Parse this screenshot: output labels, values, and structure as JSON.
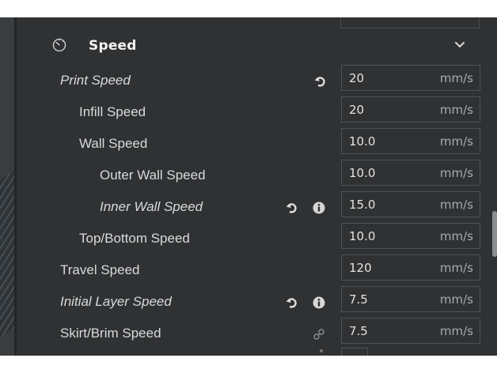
{
  "section": {
    "title": "Speed",
    "icon": "speedometer-icon",
    "chevron": "chevron-down-icon"
  },
  "rows": [
    {
      "label": "Print Speed",
      "italic": true,
      "indent": 0,
      "value": "20",
      "unit": "mm/s",
      "icons": [
        "reset-icon"
      ]
    },
    {
      "label": "Infill Speed",
      "italic": false,
      "indent": 1,
      "value": "20",
      "unit": "mm/s",
      "icons": []
    },
    {
      "label": "Wall Speed",
      "italic": false,
      "indent": 1,
      "value": "10.0",
      "unit": "mm/s",
      "icons": []
    },
    {
      "label": "Outer Wall Speed",
      "italic": false,
      "indent": 2,
      "value": "10.0",
      "unit": "mm/s",
      "icons": []
    },
    {
      "label": "Inner Wall Speed",
      "italic": true,
      "indent": 2,
      "value": "15.0",
      "unit": "mm/s",
      "icons": [
        "reset-icon",
        "info-icon"
      ]
    },
    {
      "label": "Top/Bottom Speed",
      "italic": false,
      "indent": 1,
      "value": "10.0",
      "unit": "mm/s",
      "icons": []
    },
    {
      "label": "Travel Speed",
      "italic": false,
      "indent": 0,
      "value": "120",
      "unit": "mm/s",
      "icons": []
    },
    {
      "label": "Initial Layer Speed",
      "italic": true,
      "indent": 0,
      "value": "7.5",
      "unit": "mm/s",
      "icons": [
        "reset-icon",
        "info-icon"
      ]
    },
    {
      "label": "Skirt/Brim Speed",
      "italic": false,
      "indent": 0,
      "value": "7.5",
      "unit": "mm/s",
      "icons": [
        "link-icon"
      ]
    }
  ],
  "colors": {
    "panel": "#2f3133",
    "text": "#d9dadb",
    "field_border": "#4f5254"
  }
}
